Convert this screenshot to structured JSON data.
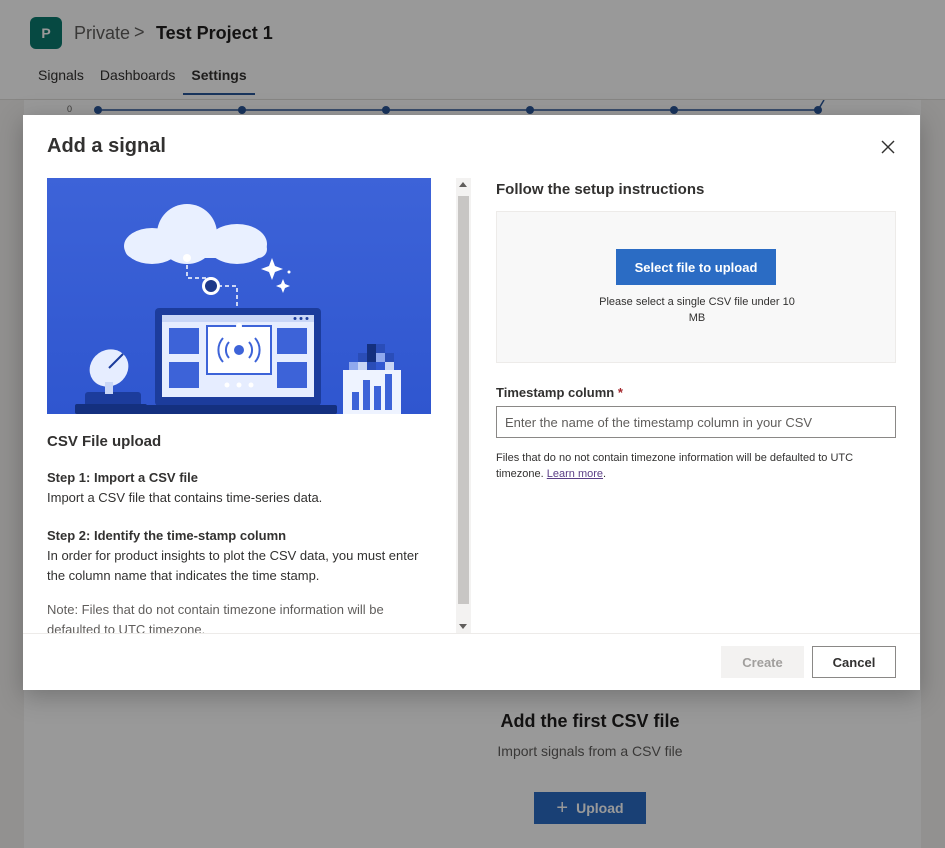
{
  "app": {
    "avatar_letter": "P",
    "breadcrumb": {
      "workspace": "Private",
      "separator": ">",
      "project": "Test Project 1"
    },
    "tabs": [
      {
        "label": "Signals",
        "active": false
      },
      {
        "label": "Dashboards",
        "active": false
      },
      {
        "label": "Settings",
        "active": true
      }
    ],
    "chart_y_label": "0",
    "empty_state": {
      "title": "Add the first CSV file",
      "subtitle": "Import signals from a CSV file",
      "upload_label": "Upload"
    }
  },
  "modal": {
    "title": "Add a signal",
    "left": {
      "heading": "CSV File upload",
      "step1_title": "Step 1: Import a CSV file",
      "step1_body": "Import a CSV file that contains time-series data.",
      "step2_title": "Step 2: Identify the time-stamp column",
      "step2_body": "In order for product insights to plot the CSV data, you must enter the column name that indicates the time stamp.",
      "note": "Note: Files that do not contain timezone information will be defaulted to UTC timezone."
    },
    "right": {
      "heading": "Follow the setup instructions",
      "select_button": "Select file to upload",
      "drop_hint": "Please select a single CSV file under 10 MB",
      "timestamp_label": "Timestamp column",
      "required_mark": "*",
      "timestamp_placeholder": "Enter the name of the timestamp column in your CSV",
      "timestamp_value": "",
      "help_text": "Files that do no not contain timezone information will be defaulted to UTC timezone.",
      "learn_more": "Learn more",
      "help_suffix": "."
    },
    "footer": {
      "create_label": "Create",
      "cancel_label": "Cancel",
      "create_enabled": false
    }
  },
  "colors": {
    "primary": "#2b6cc4",
    "brand": "#0b7a6f",
    "required": "#a4262c"
  }
}
